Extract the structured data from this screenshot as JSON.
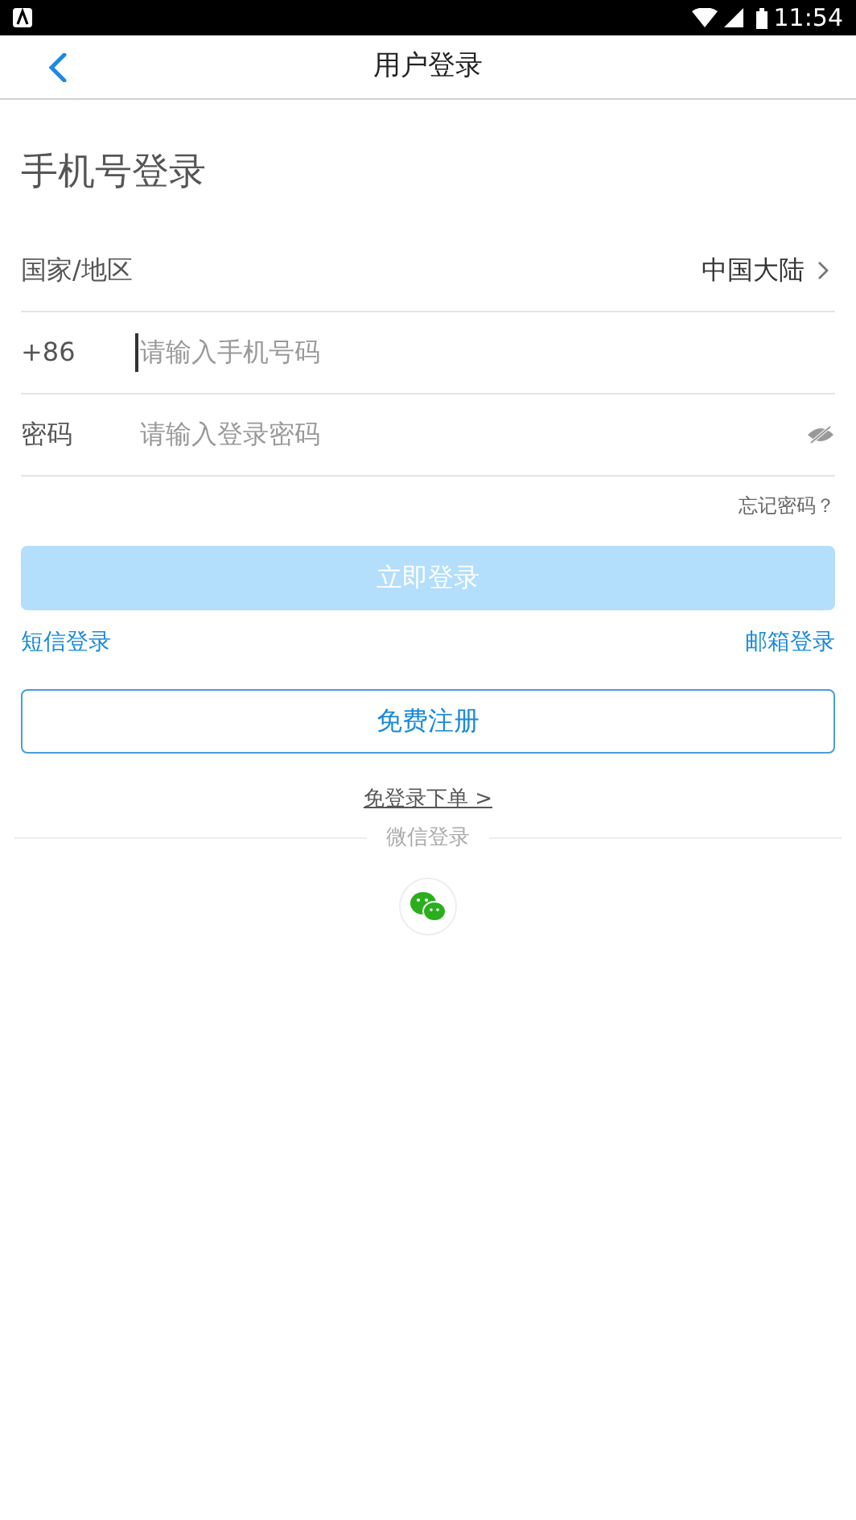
{
  "status_bar": {
    "time": "11:54"
  },
  "header": {
    "title": "用户登录"
  },
  "heading": "手机号登录",
  "region": {
    "label": "国家/地区",
    "value": "中国大陆"
  },
  "fields": [
    {
      "kind": "phone",
      "label": "+86",
      "placeholder": "请输入手机号码",
      "focused": true
    },
    {
      "kind": "password",
      "label": "密码",
      "placeholder": "请输入登录密码",
      "focused": false
    }
  ],
  "forgot_link": "忘记密码？",
  "login_button": {
    "label": "立即登录",
    "disabled": true
  },
  "alt_links": [
    "短信登录",
    "邮箱登录"
  ],
  "register_button": "免费注册",
  "guest_link": "免登录下单 >",
  "wechat_divider": "微信登录"
}
